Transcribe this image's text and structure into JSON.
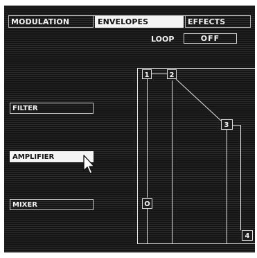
{
  "tabs": [
    {
      "label": "MODULATION",
      "active": false
    },
    {
      "label": "ENVELOPES",
      "active": true
    },
    {
      "label": "EFFECTS",
      "active": false
    }
  ],
  "loop": {
    "label": "LOOP",
    "value": "OFF"
  },
  "targets": [
    {
      "label": "FILTER",
      "active": false
    },
    {
      "label": "AMPLIFIER",
      "active": true
    },
    {
      "label": "MIXER",
      "active": false
    }
  ],
  "envelope": {
    "points": [
      {
        "label": "1"
      },
      {
        "label": "2"
      },
      {
        "label": "3"
      },
      {
        "label": "4"
      },
      {
        "label": "O"
      }
    ]
  },
  "colors": {
    "panel": "#1c1c1c",
    "line": "#e6e6e6",
    "active_bg": "#f4f4f4"
  },
  "icons": {
    "cursor": "arrow-pointer-icon"
  }
}
